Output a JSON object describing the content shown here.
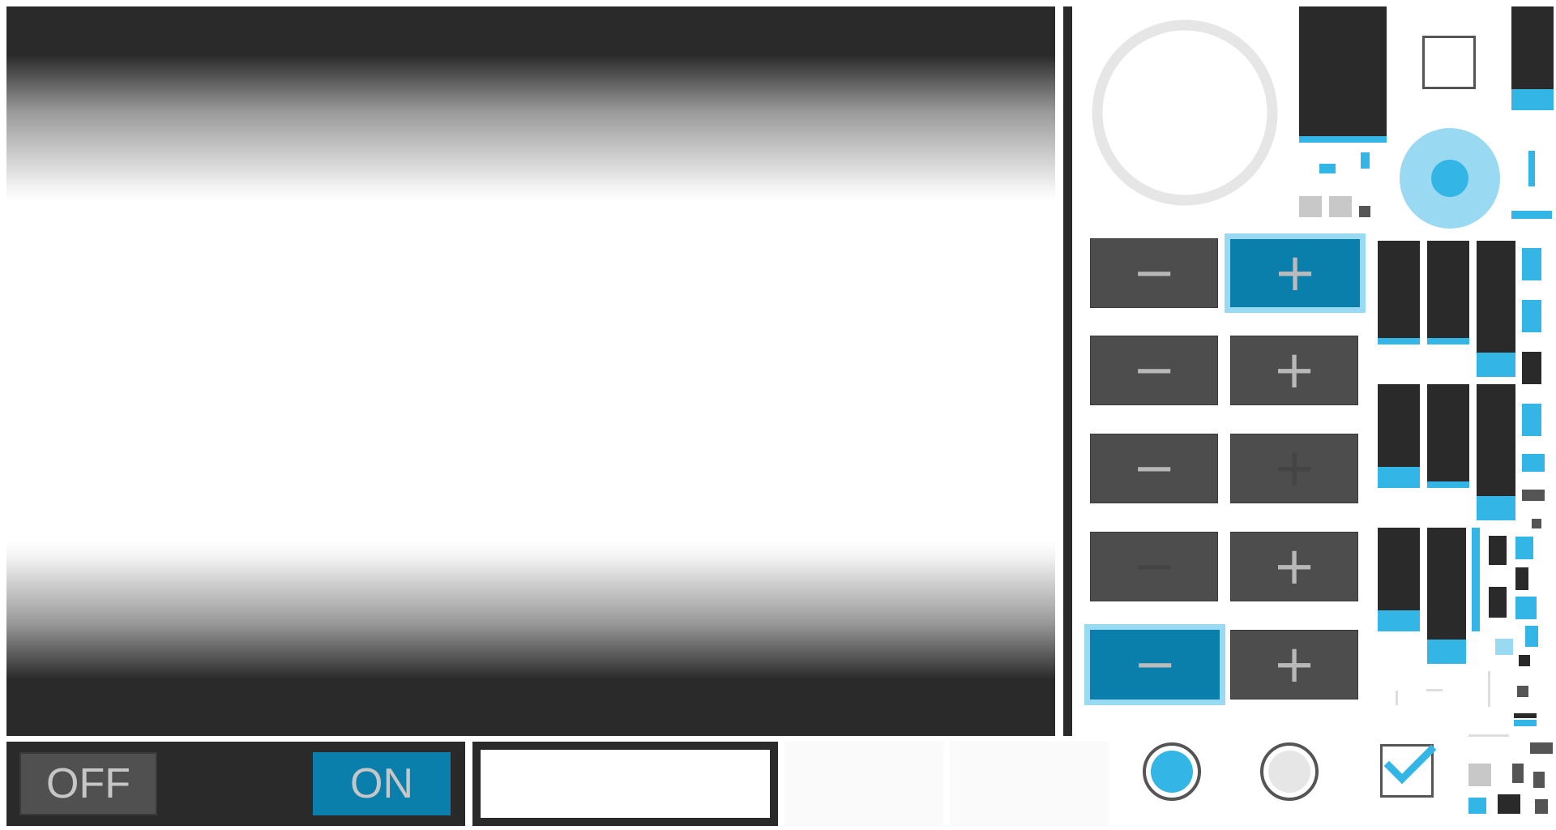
{
  "switch": {
    "off_label": "OFF",
    "on_label": "ON",
    "checked": true
  },
  "steppers": [
    {
      "minus": "−",
      "plus": "+",
      "focused": "plus"
    },
    {
      "minus": "−",
      "plus": "+",
      "focused": "none"
    },
    {
      "minus": "−",
      "plus": "+",
      "plus_disabled": true
    },
    {
      "minus": "−",
      "plus": "+",
      "minus_disabled": true
    },
    {
      "minus": "−",
      "plus": "+",
      "focused": "minus"
    }
  ],
  "text_field": {
    "value": "",
    "placeholder": ""
  },
  "radio_checked": true,
  "radio_unchecked": false,
  "checkbox_checked": true,
  "colors": {
    "dark": "#2a2a2a",
    "accent_blue": "#33b5e5",
    "pressed_blue": "#0a7fab",
    "focus_blue": "#99d9f2",
    "button_grey": "#4d4d4d"
  },
  "icons": [
    "progress-ring-icon",
    "seekbar-thumb-icon",
    "check-icon"
  ]
}
